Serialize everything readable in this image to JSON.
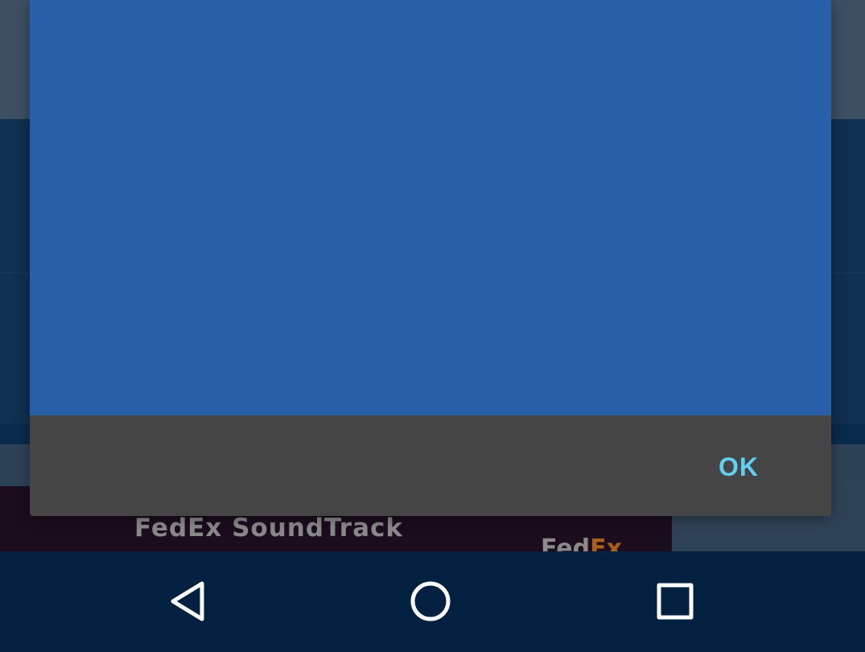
{
  "background": {
    "ad": {
      "title": "FedEx SoundTrack",
      "logo_prefix": "Fed",
      "logo_suffix": "Ex"
    }
  },
  "dialog": {
    "ok_label": "OK",
    "content_color": "#2860aa",
    "actions_color": "#454545",
    "accent_color": "#5ed0f4"
  },
  "navbar": {
    "back_icon": "back-triangle-icon",
    "home_icon": "home-circle-icon",
    "recents_icon": "recents-square-icon"
  }
}
